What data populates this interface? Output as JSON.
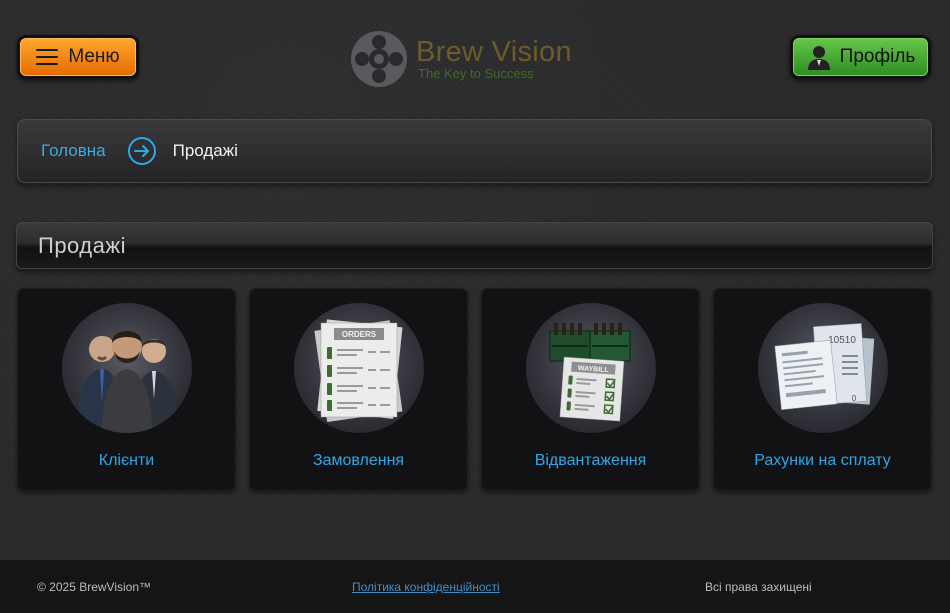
{
  "header": {
    "menu_label": "Меню",
    "logo_title": "Brew Vision",
    "logo_subtitle": "The Key to Success",
    "profile_label": "Профіль"
  },
  "breadcrumb": {
    "home": "Головна",
    "current": "Продажі"
  },
  "section": {
    "title": "Продажі"
  },
  "cards": [
    {
      "label": "Клієнти",
      "icon": "clients-icon"
    },
    {
      "label": "Замовлення",
      "icon": "orders-icon",
      "image_text": "ORDERS"
    },
    {
      "label": "Відвантаження",
      "icon": "waybill-icon",
      "image_text": "WAYBILL"
    },
    {
      "label": "Рахунки на сплату",
      "icon": "invoices-icon",
      "image_text": "10510"
    }
  ],
  "footer": {
    "copyright": "© 2025 BrewVision™",
    "privacy": "Політика конфіденційності",
    "rights": "Всі права захищені"
  },
  "colors": {
    "accent_blue": "#2fa7e8",
    "menu_orange": "#f08a12",
    "profile_green": "#4aab34",
    "background": "#2a2a2c"
  }
}
